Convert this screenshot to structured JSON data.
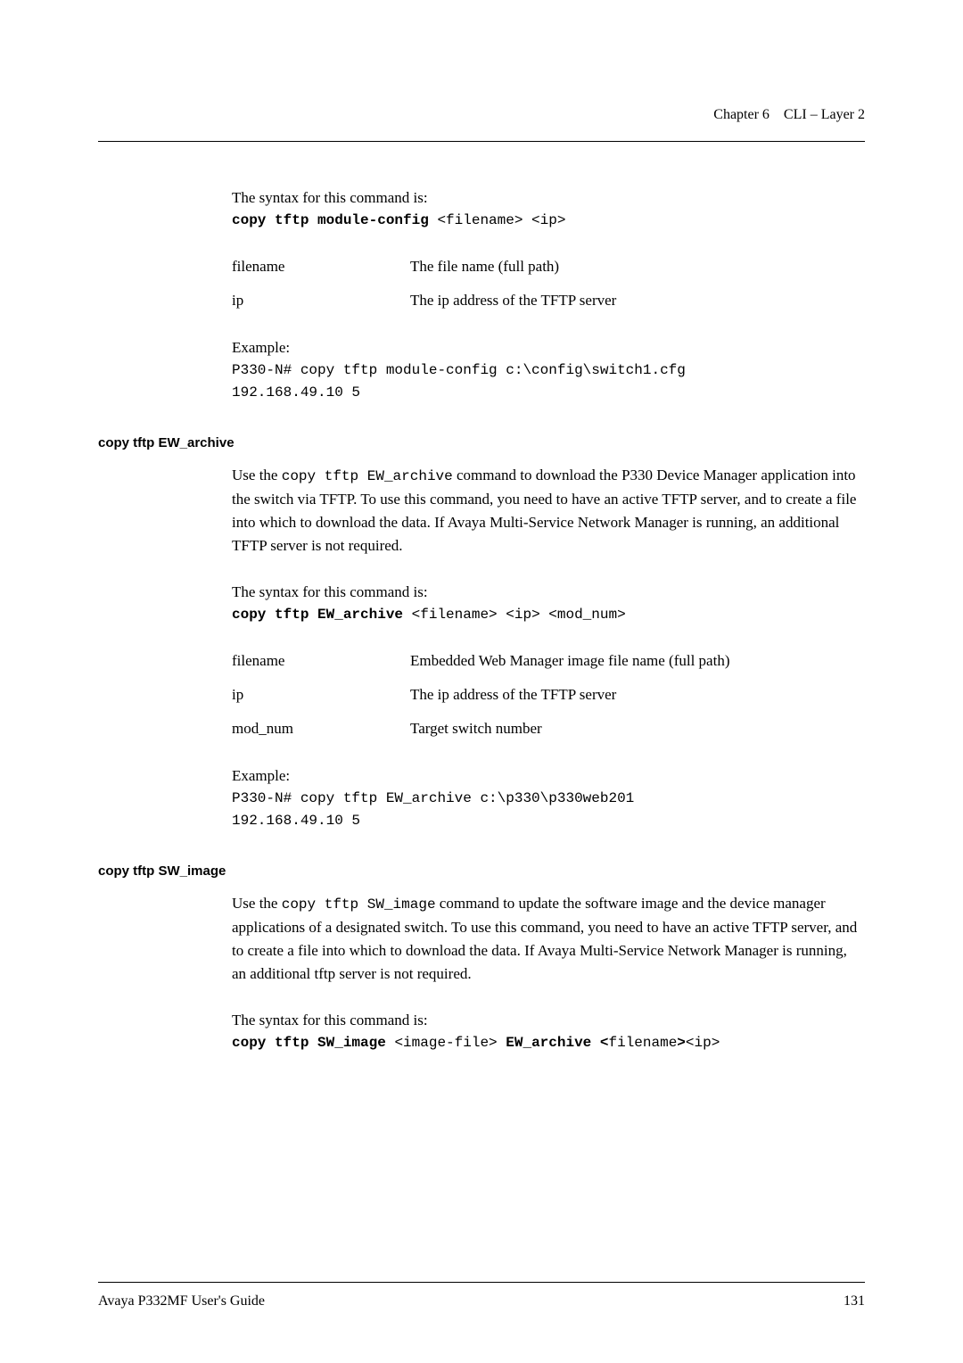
{
  "header": {
    "chapter": "Chapter 6",
    "title": "CLI – Layer 2"
  },
  "section1": {
    "intro": "The syntax for this command is:",
    "cmdPrefix": "copy tftp module-config ",
    "cmdArgs": "<filename> <ip>",
    "params": [
      {
        "name": "filename",
        "desc": "The file name (full path)"
      },
      {
        "name": "ip",
        "desc": "The ip address of the TFTP server"
      }
    ],
    "exampleLabel": "Example:",
    "exampleLine1": "P330-N# copy tftp module-config  c:\\config\\switch1.cfg",
    "exampleLine2": "192.168.49.10 5"
  },
  "section2": {
    "heading": "copy tftp EW_archive",
    "descPart1": "Use the ",
    "descCode": "copy tftp EW_archive",
    "descPart2": " command to download the P330 Device Manager application into the switch via TFTP. To use this command, you need to have an active TFTP server, and to create a file into which to download the data. If Avaya Multi-Service Network Manager is running, an additional TFTP server is not required.",
    "intro": "The syntax for this command is:",
    "cmdPrefix": "copy tftp EW_archive ",
    "cmdArgs": "<filename> <ip> <mod_num>",
    "params": [
      {
        "name": "filename",
        "desc": "Embedded Web Manager image file name (full path)"
      },
      {
        "name": "ip",
        "desc": "The ip address of the TFTP server"
      },
      {
        "name": "mod_num",
        "desc": "Target switch number"
      }
    ],
    "exampleLabel": "Example:",
    "exampleLine1": "P330-N# copy tftp EW_archive c:\\p330\\p330web201",
    "exampleLine2": "192.168.49.10 5"
  },
  "section3": {
    "heading": "copy tftp SW_image",
    "descPart1": "Use the ",
    "descCode": "copy tftp SW_image",
    "descPart2": " command to update the software image and the device manager applications of a designated switch. To use this command, you need to have an active TFTP server, and to create a file into which to download the data. If Avaya Multi-Service Network Manager is running, an additional tftp server is not required.",
    "intro": "The syntax for this command is:",
    "cmdPrefix": "copy tftp SW_image ",
    "cmdArg1": "<image-file>",
    "cmdMid": " EW_archive <",
    "cmdArg2": "filename",
    "cmdMid2": ">",
    "cmdArg3": "<ip>"
  },
  "footer": {
    "left": "Avaya P332MF User's Guide",
    "right": "131"
  }
}
